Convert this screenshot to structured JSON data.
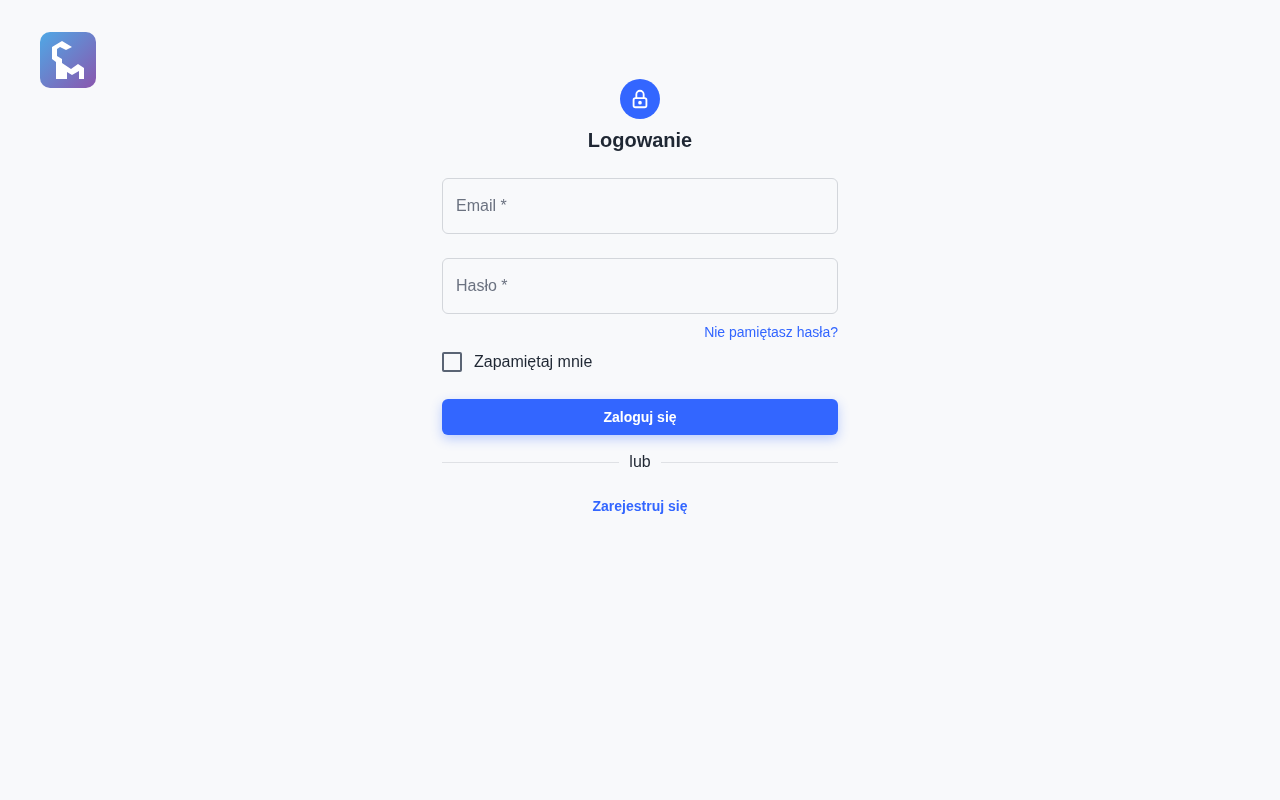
{
  "title": "Logowanie",
  "fields": [
    {
      "placeholder": "Email *"
    },
    {
      "placeholder": "Hasło *"
    }
  ],
  "forgot_link": "Nie pamiętasz hasła?",
  "remember": {
    "label": "Zapamiętaj mnie",
    "checked": false
  },
  "submit": "Zaloguj się",
  "divider": "lub",
  "register_link": "Zarejestruj się"
}
